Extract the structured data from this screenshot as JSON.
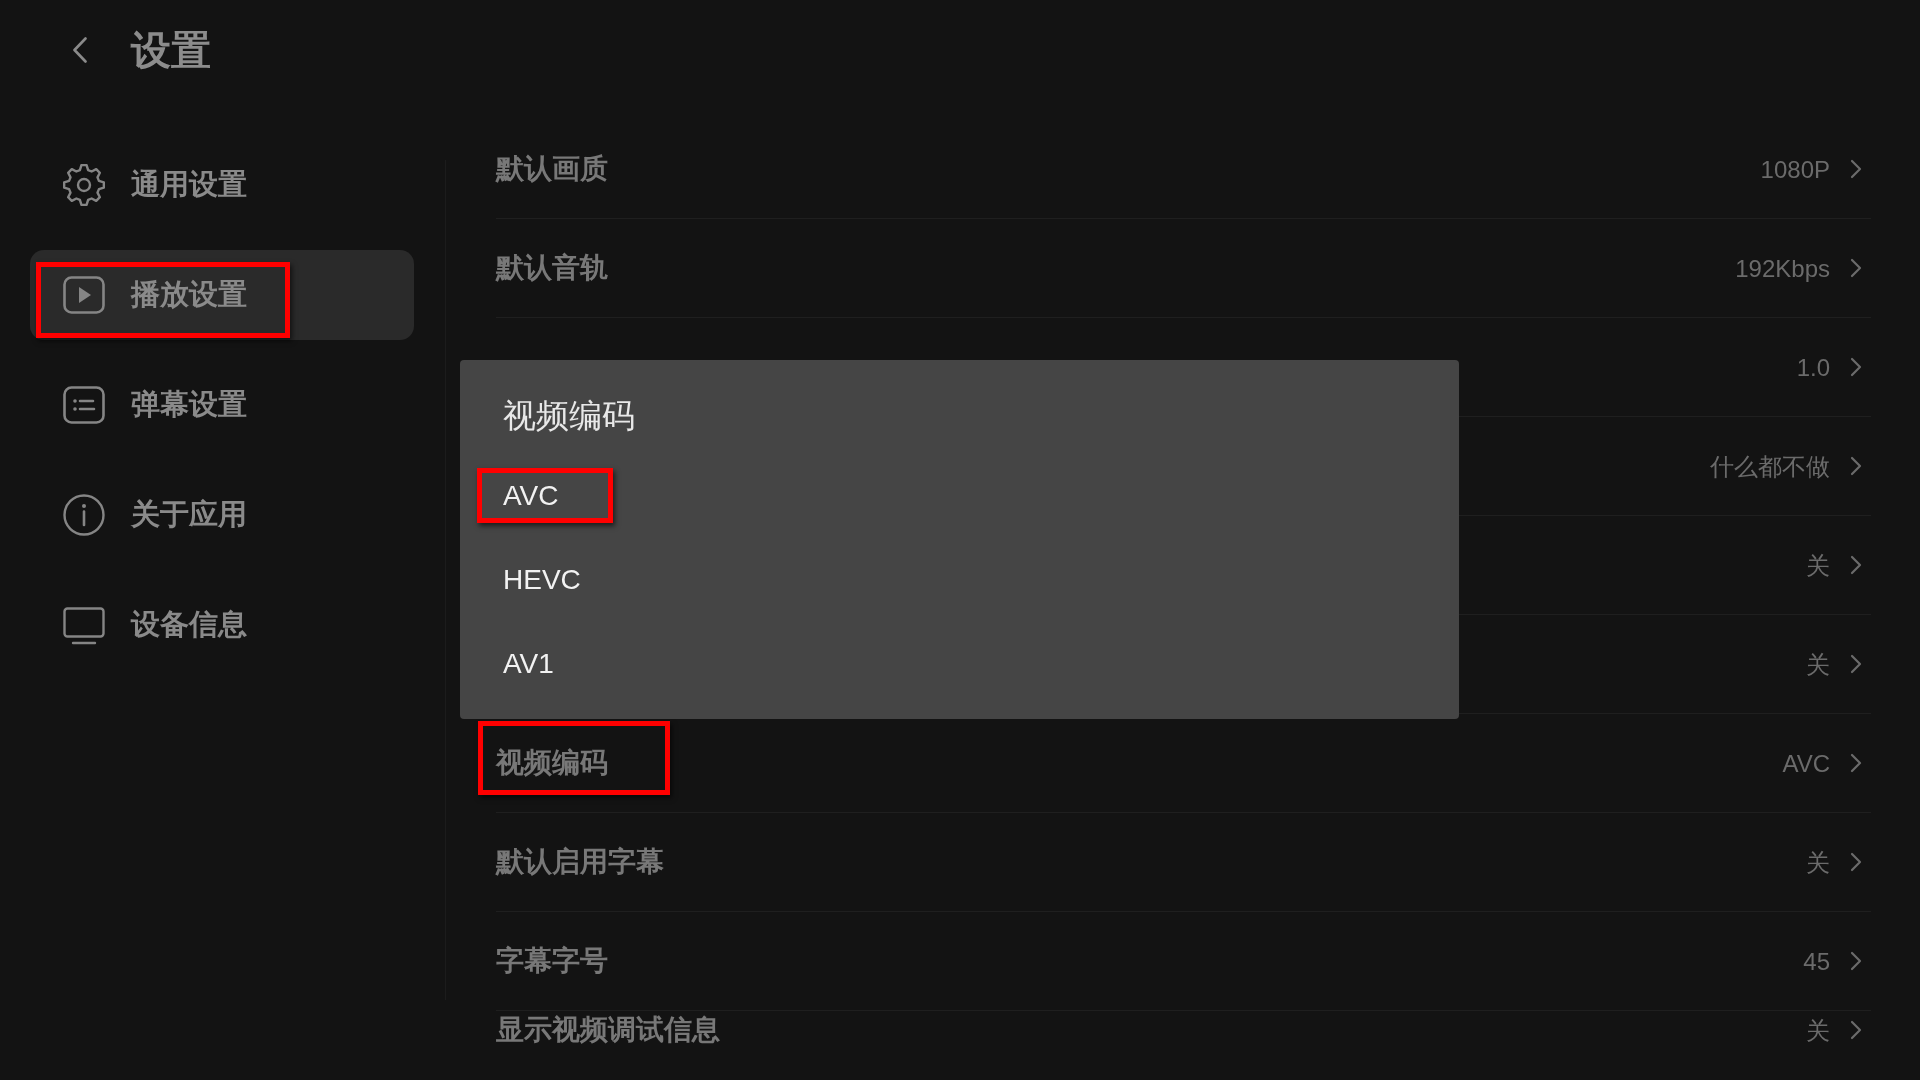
{
  "header": {
    "title": "设置"
  },
  "sidebar": {
    "items": [
      {
        "label": "通用设置",
        "selected": false,
        "marked": false
      },
      {
        "label": "播放设置",
        "selected": true,
        "marked": true
      },
      {
        "label": "弹幕设置",
        "selected": false,
        "marked": false
      },
      {
        "label": "关于应用",
        "selected": false,
        "marked": false
      },
      {
        "label": "设备信息",
        "selected": false,
        "marked": false
      }
    ]
  },
  "settings": {
    "rows": [
      {
        "label": "默认画质",
        "value": "1080P",
        "marked": false
      },
      {
        "label": "默认音轨",
        "value": "192Kbps",
        "marked": false
      },
      {
        "value": "1.0",
        "marked": false
      },
      {
        "value": "什么都不做",
        "marked": false
      },
      {
        "value": "关",
        "marked": false
      },
      {
        "value": "关",
        "marked": false
      },
      {
        "label": "视频编码",
        "value": "AVC",
        "marked": true
      },
      {
        "label": "默认启用字幕",
        "value": "关",
        "marked": false
      },
      {
        "label": "字幕字号",
        "value": "45",
        "marked": false
      },
      {
        "label": "显示视频调试信息",
        "value": "关",
        "marked": false
      }
    ]
  },
  "dialog": {
    "title": "视频编码",
    "options": [
      {
        "label": "AVC",
        "marked": true
      },
      {
        "label": "HEVC",
        "marked": false
      },
      {
        "label": "AV1",
        "marked": false
      }
    ]
  }
}
